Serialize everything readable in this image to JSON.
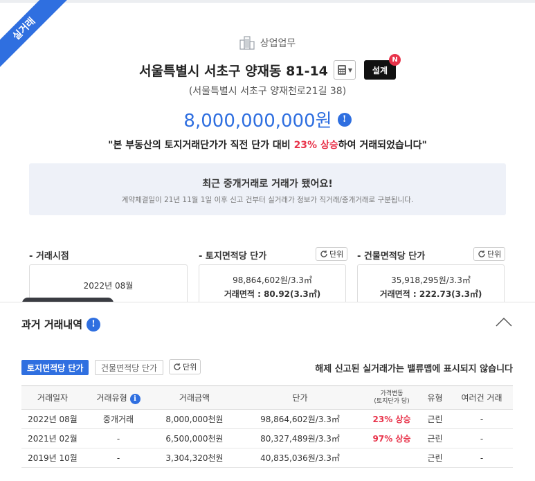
{
  "ribbon": "실거래",
  "header": {
    "category": "상업업무",
    "address": "서울특별시 서초구 양재동 81-14",
    "design_button": "설계",
    "design_badge": "N",
    "road_address": "(서울특별시 서초구 양재천로21길 38)",
    "price": "8,000,000,000원",
    "compare_prefix": "\"본 부동산의 토지거래단가가 직전 단가 대비 ",
    "compare_pct": "23% 상승",
    "compare_suffix": "하여 거래되었습니다\""
  },
  "notice": {
    "title": "최근 중개거래로 거래가 됐어요!",
    "subtitle": "계약체결일이 21년 11월 1일 이후 신고 건부터 실거래가 정보가 직거래/중개거래로 구분됩니다."
  },
  "summary": {
    "unit_label": "단위",
    "deal_time": {
      "label": "- 거래시점",
      "value": "2022년 08월"
    },
    "land_price": {
      "label": "- 토지면적당 단가",
      "value": "98,864,602원/3.3㎡",
      "area": "거래면적 : 80.92(3.3㎡)"
    },
    "bldg_price": {
      "label": "- 건물면적당 단가",
      "value": "35,918,295원/3.3㎡",
      "area": "거래면적 : 222.73(3.3㎡)"
    }
  },
  "history": {
    "title": "과거 거래내역",
    "tabs": [
      "토지면적당 단가",
      "건물면적당 단가"
    ],
    "unit_label": "단위",
    "hidden_note": "해제 신고된 실거래가는 밸류맵에 표시되지 않습니다",
    "columns": [
      "거래일자",
      "거래유형",
      "거래금액",
      "단가",
      "가격변동\n(토지단가 당)",
      "유형",
      "여러건 거래"
    ],
    "rows": [
      {
        "date": "2022년 08월",
        "type": "중개거래",
        "amount": "8,000,000천원",
        "unit_price": "98,864,602원/3.3㎡",
        "change": "23% 상승",
        "kind": "근린",
        "multi": "-"
      },
      {
        "date": "2021년 02월",
        "type": "-",
        "amount": "6,500,000천원",
        "unit_price": "80,327,489원/3.3㎡",
        "change": "97% 상승",
        "kind": "근린",
        "multi": "-"
      },
      {
        "date": "2019년 10월",
        "type": "-",
        "amount": "3,304,320천원",
        "unit_price": "40,835,036원/3.3㎡",
        "change": "",
        "kind": "근린",
        "multi": "-"
      }
    ]
  },
  "colors": {
    "accent": "#2f6fe0",
    "up": "#e8334a",
    "badge": "#e8334a"
  },
  "icons": [
    "building-icon",
    "calculator-icon",
    "info-icon",
    "refresh-icon",
    "chevron-up-icon"
  ]
}
